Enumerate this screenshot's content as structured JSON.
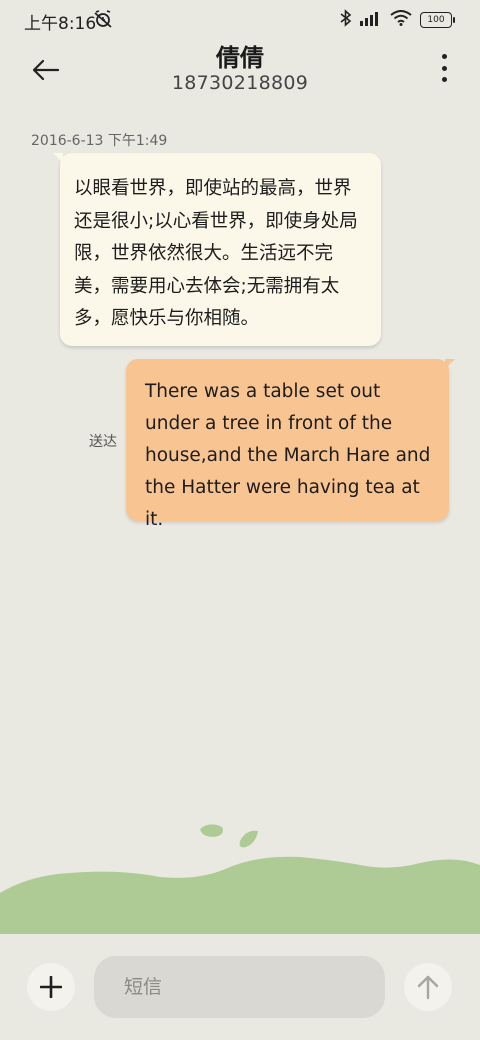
{
  "status_bar": {
    "time": "上午8:16",
    "battery": "100",
    "icons": [
      "mute-alarm-icon",
      "bluetooth-icon",
      "signal-icon",
      "wifi-icon",
      "battery-icon"
    ]
  },
  "header": {
    "contact_name": "倩倩",
    "phone_number": "18730218809",
    "back_icon": "arrow-left-icon",
    "more_icon": "more-vertical-icon"
  },
  "conversation": {
    "timestamp": "2016-6-13 下午1:49",
    "incoming_message": "以眼看世界，即使站的最高，世界还是很小;以心看世界，即使身处局限，世界依然很大。生活远不完美，需要用心去体会;无需拥有太多，愿快乐与你相随。",
    "outgoing_message": "There was a table set out under a tree in front of the house,and the March Hare and the Hatter were having tea at it.",
    "delivery_status": "送达"
  },
  "composer": {
    "placeholder": "短信",
    "value": "",
    "add_icon": "plus-icon",
    "send_icon": "arrow-up-icon"
  },
  "colors": {
    "background": "#e9e8e1",
    "incoming_bubble": "#fbf8ea",
    "outgoing_bubble": "#f7c492",
    "hills": "#aecb96"
  }
}
